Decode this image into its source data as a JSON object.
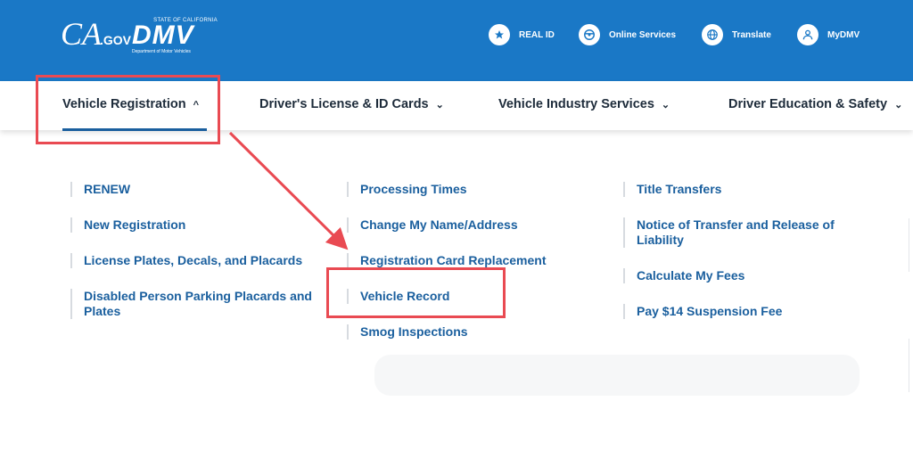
{
  "header": {
    "cagov_logo": {
      "main": "CA",
      "suffix": ".GOV"
    },
    "dmv_logo": {
      "state": "STATE OF CALIFORNIA",
      "name": "DMV",
      "dept": "Department of Motor Vehicles"
    },
    "utility_links": [
      {
        "label": "REAL ID",
        "icon": "star-icon"
      },
      {
        "label": "Online Services",
        "icon": "steering-wheel-icon"
      },
      {
        "label": "Translate",
        "icon": "globe-icon"
      },
      {
        "label": "MyDMV",
        "icon": "user-icon"
      }
    ]
  },
  "nav": {
    "items": [
      {
        "label": "Vehicle Registration",
        "chevron": "^"
      },
      {
        "label": "Driver's License & ID Cards",
        "chevron": "⌄"
      },
      {
        "label": "Vehicle Industry Services",
        "chevron": "⌄"
      },
      {
        "label": "Driver Education & Safety",
        "chevron": "⌄"
      }
    ]
  },
  "menu": {
    "col1": [
      "RENEW",
      "New Registration",
      "License Plates, Decals, and Placards",
      "Disabled Person Parking Placards and Plates"
    ],
    "col2": [
      "Processing Times",
      "Change My Name/Address",
      "Registration Card Replacement",
      "Vehicle Record",
      "Smog Inspections"
    ],
    "col3": [
      "Title Transfers",
      "Notice of Transfer and Release of Liability",
      "Calculate My Fees",
      "Pay $14 Suspension Fee"
    ]
  },
  "annotation": {
    "color": "#e94a52"
  }
}
